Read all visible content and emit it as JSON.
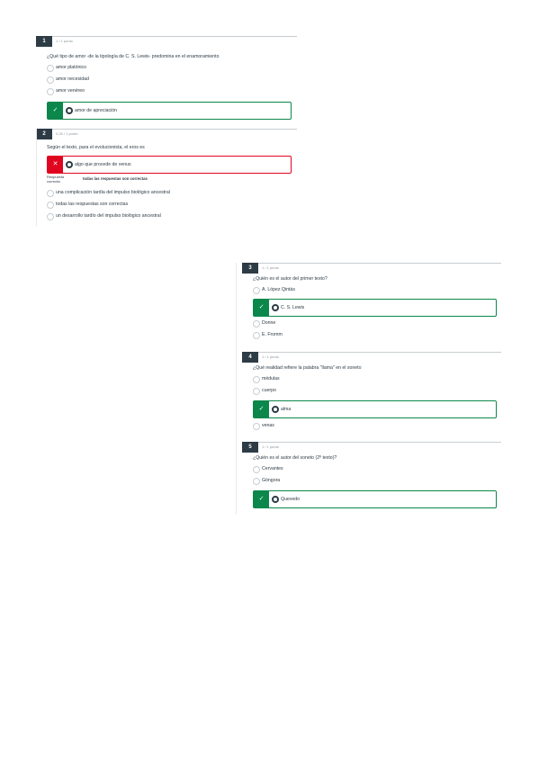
{
  "q1": {
    "number": "1",
    "score": "1 / 1 punto",
    "question": "¿Qué tipo de amor -de la tipología de C. S. Lewis- predomina en el enamoramiento",
    "options": [
      "amor platónico",
      "amor necesidad",
      "amor venéreo"
    ],
    "selected": "amor de apreciación",
    "mark": "✓"
  },
  "q2": {
    "number": "2",
    "score": "0,25 / 1 punto",
    "question": "Según el texto, para el evolucionista, el eros es",
    "selected": "algo que procede de venus",
    "mark": "✕",
    "correct_label": "Respuesta correcta:",
    "correct_value": "todas las respuestas son correctas",
    "options": [
      "una complicación tardía del impulso biológico ancestral",
      "todas las respuestas son correctas",
      "un desarrollo tardío del impulso biológico ancestral"
    ]
  },
  "q3": {
    "number": "3",
    "score": "1 / 1 punto",
    "question": "¿Quién es el autor del primer texto?",
    "options_before": [
      "A. López Qintás"
    ],
    "selected": "C. S. Lewis",
    "options_after": [
      "Donne",
      "E. Fromm"
    ],
    "mark": "✓"
  },
  "q4": {
    "number": "4",
    "score": "1 / 1 punto",
    "question": "¿Qué realidad refiere la palabra \"llama\" en el soneto",
    "options_before": [
      "médulas",
      "cuerpo"
    ],
    "selected": "alma",
    "options_after": [
      "venas"
    ],
    "mark": "✓"
  },
  "q5": {
    "number": "5",
    "score": "1 / 1 punto",
    "question": "¿Quién es el autor del soneto (2º texto)?",
    "options_before": [
      "Cervantes",
      "Góngora"
    ],
    "selected": "Quevedo",
    "mark": "✓"
  },
  "colors": {
    "correct": "#0b874b",
    "wrong": "#e0061f",
    "header": "#2d3b45"
  }
}
